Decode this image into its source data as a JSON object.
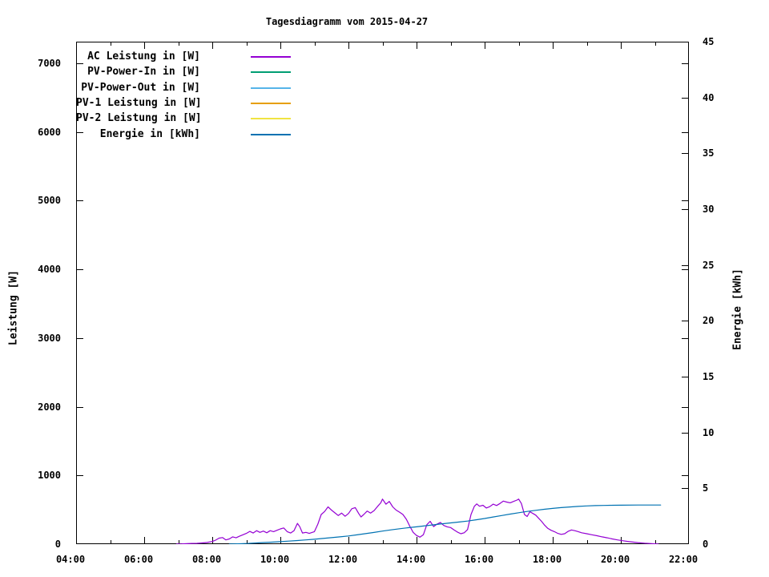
{
  "colors": {
    "background": "#ffffff",
    "foreground": "#000000"
  },
  "chart_data": {
    "type": "line",
    "title": "Tagesdiagramm vom 2015-04-27",
    "x_axis": {
      "tick_labels": [
        "04:00",
        "06:00",
        "08:00",
        "10:00",
        "12:00",
        "14:00",
        "16:00",
        "18:00",
        "20:00",
        "22:00"
      ],
      "tick_hours": [
        4,
        6,
        8,
        10,
        12,
        14,
        16,
        18,
        20,
        22
      ],
      "minor_tick_hours": [
        5,
        7,
        9,
        11,
        13,
        15,
        17,
        19,
        21
      ],
      "range_hours": [
        4,
        22
      ]
    },
    "y_axis_left": {
      "label": "Leistung [W]",
      "tick_labels": [
        "0",
        "1000",
        "2000",
        "3000",
        "4000",
        "5000",
        "6000",
        "7000"
      ],
      "ticks": [
        0,
        1000,
        2000,
        3000,
        4000,
        5000,
        6000,
        7000
      ],
      "range": [
        0,
        7315
      ]
    },
    "y_axis_right": {
      "label": "Energie [kWh]",
      "tick_labels": [
        "0",
        "5",
        "10",
        "15",
        "20",
        "25",
        "30",
        "35",
        "40",
        "45"
      ],
      "ticks": [
        0,
        5,
        10,
        15,
        20,
        25,
        30,
        35,
        40,
        45
      ],
      "range": [
        0,
        45
      ]
    },
    "legend_position": "top-left-inside",
    "grid": false,
    "legend": [
      {
        "label": "AC Leistung in [W]",
        "color": "#9400d3"
      },
      {
        "label": "PV-Power-In in [W]",
        "color": "#009e73"
      },
      {
        "label": "PV-Power-Out in [W]",
        "color": "#56b4e9"
      },
      {
        "label": "PV-1 Leistung in [W]",
        "color": "#e69f00"
      },
      {
        "label": "PV-2 Leistung in [W]",
        "color": "#f0e442"
      },
      {
        "label": "Energie in [kWh]",
        "color": "#0072b2"
      }
    ],
    "series": [
      {
        "name": "AC Leistung in [W]",
        "slug": "ac-leistung",
        "color": "#9400d3",
        "axis": "left",
        "unit": "W",
        "points": [
          [
            6.95,
            2
          ],
          [
            7.1,
            4
          ],
          [
            7.25,
            7
          ],
          [
            7.4,
            10
          ],
          [
            7.55,
            12
          ],
          [
            7.7,
            18
          ],
          [
            7.85,
            24
          ],
          [
            8.0,
            38
          ],
          [
            8.1,
            58
          ],
          [
            8.2,
            88
          ],
          [
            8.3,
            96
          ],
          [
            8.4,
            62
          ],
          [
            8.5,
            76
          ],
          [
            8.6,
            106
          ],
          [
            8.7,
            92
          ],
          [
            8.8,
            116
          ],
          [
            8.9,
            136
          ],
          [
            9.0,
            156
          ],
          [
            9.1,
            186
          ],
          [
            9.2,
            162
          ],
          [
            9.3,
            196
          ],
          [
            9.4,
            172
          ],
          [
            9.5,
            190
          ],
          [
            9.6,
            166
          ],
          [
            9.7,
            196
          ],
          [
            9.8,
            182
          ],
          [
            9.9,
            202
          ],
          [
            10.0,
            222
          ],
          [
            10.1,
            236
          ],
          [
            10.2,
            182
          ],
          [
            10.3,
            162
          ],
          [
            10.4,
            196
          ],
          [
            10.5,
            302
          ],
          [
            10.57,
            254
          ],
          [
            10.65,
            162
          ],
          [
            10.75,
            172
          ],
          [
            10.85,
            156
          ],
          [
            11.0,
            182
          ],
          [
            11.1,
            292
          ],
          [
            11.2,
            432
          ],
          [
            11.3,
            476
          ],
          [
            11.4,
            542
          ],
          [
            11.5,
            496
          ],
          [
            11.6,
            456
          ],
          [
            11.7,
            416
          ],
          [
            11.8,
            452
          ],
          [
            11.9,
            406
          ],
          [
            12.0,
            446
          ],
          [
            12.1,
            516
          ],
          [
            12.2,
            532
          ],
          [
            12.3,
            446
          ],
          [
            12.37,
            396
          ],
          [
            12.45,
            432
          ],
          [
            12.55,
            482
          ],
          [
            12.65,
            452
          ],
          [
            12.75,
            486
          ],
          [
            12.85,
            546
          ],
          [
            12.95,
            602
          ],
          [
            13.0,
            656
          ],
          [
            13.1,
            582
          ],
          [
            13.2,
            622
          ],
          [
            13.3,
            542
          ],
          [
            13.4,
            496
          ],
          [
            13.5,
            466
          ],
          [
            13.6,
            432
          ],
          [
            13.7,
            362
          ],
          [
            13.8,
            262
          ],
          [
            13.9,
            172
          ],
          [
            14.0,
            126
          ],
          [
            14.1,
            102
          ],
          [
            14.2,
            136
          ],
          [
            14.3,
            282
          ],
          [
            14.4,
            332
          ],
          [
            14.5,
            256
          ],
          [
            14.6,
            292
          ],
          [
            14.7,
            316
          ],
          [
            14.8,
            272
          ],
          [
            14.9,
            252
          ],
          [
            15.0,
            242
          ],
          [
            15.1,
            206
          ],
          [
            15.2,
            176
          ],
          [
            15.3,
            152
          ],
          [
            15.4,
            166
          ],
          [
            15.5,
            212
          ],
          [
            15.6,
            432
          ],
          [
            15.7,
            552
          ],
          [
            15.77,
            586
          ],
          [
            15.85,
            552
          ],
          [
            15.95,
            566
          ],
          [
            16.05,
            526
          ],
          [
            16.15,
            546
          ],
          [
            16.25,
            582
          ],
          [
            16.35,
            562
          ],
          [
            16.45,
            592
          ],
          [
            16.55,
            626
          ],
          [
            16.65,
            612
          ],
          [
            16.75,
            602
          ],
          [
            16.85,
            622
          ],
          [
            16.95,
            642
          ],
          [
            17.0,
            656
          ],
          [
            17.08,
            592
          ],
          [
            17.17,
            432
          ],
          [
            17.25,
            402
          ],
          [
            17.33,
            472
          ],
          [
            17.42,
            446
          ],
          [
            17.5,
            422
          ],
          [
            17.58,
            382
          ],
          [
            17.67,
            332
          ],
          [
            17.75,
            282
          ],
          [
            17.85,
            232
          ],
          [
            17.95,
            202
          ],
          [
            18.05,
            182
          ],
          [
            18.15,
            156
          ],
          [
            18.25,
            142
          ],
          [
            18.35,
            152
          ],
          [
            18.45,
            186
          ],
          [
            18.55,
            206
          ],
          [
            18.65,
            196
          ],
          [
            18.75,
            182
          ],
          [
            18.85,
            166
          ],
          [
            19.0,
            152
          ],
          [
            19.15,
            136
          ],
          [
            19.3,
            122
          ],
          [
            19.45,
            106
          ],
          [
            19.6,
            92
          ],
          [
            19.75,
            76
          ],
          [
            19.9,
            62
          ],
          [
            20.05,
            50
          ],
          [
            20.2,
            40
          ],
          [
            20.35,
            30
          ],
          [
            20.5,
            22
          ],
          [
            20.7,
            14
          ],
          [
            20.9,
            8
          ],
          [
            21.05,
            4
          ],
          [
            21.1,
            2
          ]
        ]
      },
      {
        "name": "Energie in [kWh]",
        "slug": "energie",
        "color": "#0072b2",
        "axis": "right",
        "unit": "kWh",
        "points": [
          [
            8.5,
            0.01
          ],
          [
            8.75,
            0.03
          ],
          [
            9.0,
            0.06
          ],
          [
            9.25,
            0.1
          ],
          [
            9.5,
            0.14
          ],
          [
            9.75,
            0.18
          ],
          [
            10.0,
            0.22
          ],
          [
            10.25,
            0.27
          ],
          [
            10.5,
            0.32
          ],
          [
            10.75,
            0.38
          ],
          [
            11.0,
            0.44
          ],
          [
            11.25,
            0.51
          ],
          [
            11.5,
            0.58
          ],
          [
            11.75,
            0.65
          ],
          [
            12.0,
            0.73
          ],
          [
            12.25,
            0.83
          ],
          [
            12.5,
            0.94
          ],
          [
            12.75,
            1.05
          ],
          [
            13.0,
            1.17
          ],
          [
            13.25,
            1.28
          ],
          [
            13.5,
            1.38
          ],
          [
            13.75,
            1.47
          ],
          [
            14.0,
            1.55
          ],
          [
            14.25,
            1.64
          ],
          [
            14.5,
            1.73
          ],
          [
            14.75,
            1.82
          ],
          [
            15.0,
            1.9
          ],
          [
            15.25,
            1.98
          ],
          [
            15.5,
            2.07
          ],
          [
            15.75,
            2.18
          ],
          [
            16.0,
            2.3
          ],
          [
            16.25,
            2.43
          ],
          [
            16.5,
            2.56
          ],
          [
            16.75,
            2.69
          ],
          [
            17.0,
            2.81
          ],
          [
            17.25,
            2.93
          ],
          [
            17.5,
            3.03
          ],
          [
            17.75,
            3.12
          ],
          [
            18.0,
            3.2
          ],
          [
            18.25,
            3.27
          ],
          [
            18.5,
            3.33
          ],
          [
            18.75,
            3.38
          ],
          [
            19.0,
            3.42
          ],
          [
            19.25,
            3.45
          ],
          [
            19.5,
            3.47
          ],
          [
            19.75,
            3.48
          ],
          [
            20.0,
            3.49
          ],
          [
            20.5,
            3.5
          ],
          [
            21.0,
            3.5
          ],
          [
            21.17,
            3.5
          ]
        ]
      }
    ]
  }
}
